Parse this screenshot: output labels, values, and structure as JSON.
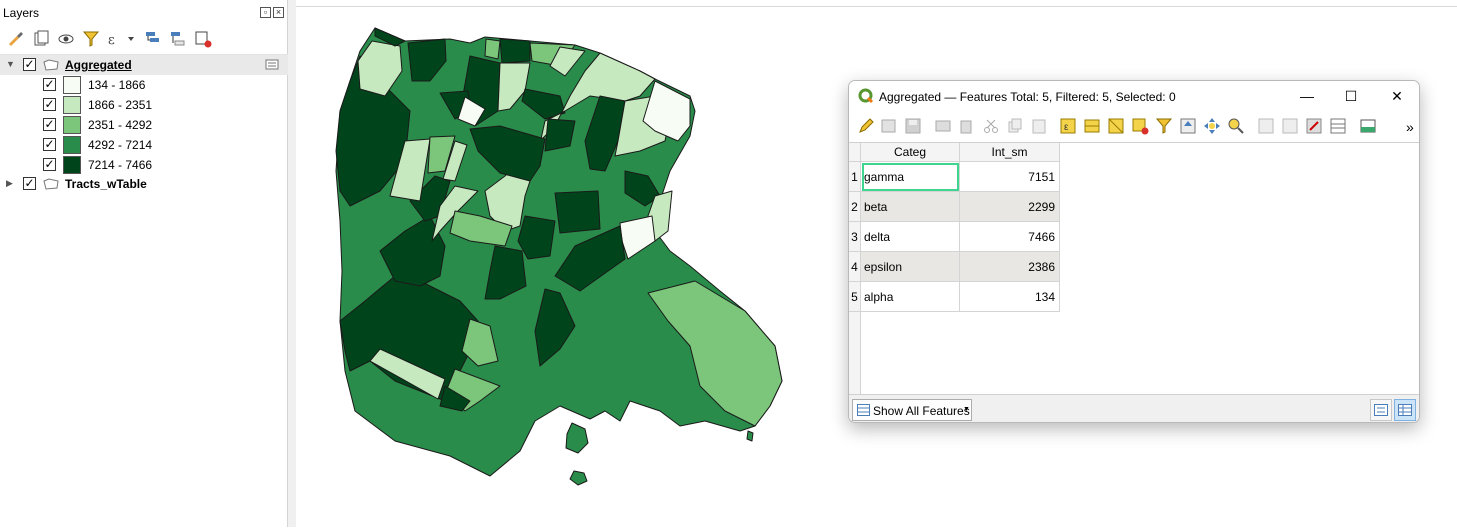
{
  "layers_panel": {
    "title": "Layers",
    "layers": [
      {
        "name": "Aggregated",
        "checked": true,
        "expanded": true,
        "legend": [
          {
            "label": "134 - 1866",
            "color": "#f7fcf5"
          },
          {
            "label": "1866 - 2351",
            "color": "#c7e9c0"
          },
          {
            "label": "2351 - 4292",
            "color": "#7bc67b"
          },
          {
            "label": "4292 - 7214",
            "color": "#2a8c4a"
          },
          {
            "label": "7214 - 7466",
            "color": "#00441b"
          }
        ]
      },
      {
        "name": "Tracts_wTable",
        "checked": true,
        "expanded": false
      }
    ]
  },
  "attribute_table": {
    "title": "Aggregated — Features Total: 5, Filtered: 5, Selected: 0",
    "columns": [
      "Categ",
      "Int_sm"
    ],
    "rows": [
      {
        "num": "1",
        "categ": "gamma",
        "value": "7151"
      },
      {
        "num": "2",
        "categ": "beta",
        "value": "2299"
      },
      {
        "num": "3",
        "categ": "delta",
        "value": "7466"
      },
      {
        "num": "4",
        "categ": "epsilon",
        "value": "2386"
      },
      {
        "num": "5",
        "categ": "alpha",
        "value": "134"
      }
    ],
    "show_all_button": "Show All Features",
    "overflow": "»"
  },
  "colors": {
    "class1": "#f7fcf5",
    "class2": "#c7e9c0",
    "class3": "#7bc67b",
    "class4": "#2a8c4a",
    "class5": "#00441b",
    "focus": "#3fd590"
  }
}
